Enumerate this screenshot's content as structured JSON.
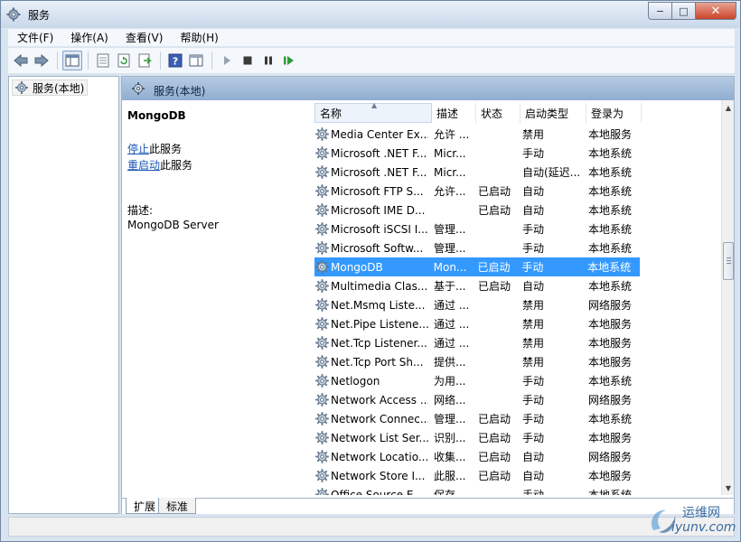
{
  "window": {
    "title": "服务",
    "controls": {
      "minimize": "−",
      "maximize": "□",
      "close": "✕"
    }
  },
  "menu": [
    "文件(F)",
    "操作(A)",
    "查看(V)",
    "帮助(H)"
  ],
  "toolbar": {
    "icons": [
      "back-arrow-icon",
      "forward-arrow-icon",
      "console-tree-icon",
      "properties-icon",
      "refresh-icon",
      "export-list-icon",
      "help-icon",
      "action-pane-icon",
      "start-service-icon",
      "stop-service-icon",
      "pause-service-icon",
      "restart-service-icon"
    ]
  },
  "tree": {
    "root_label": "服务(本地)"
  },
  "pane_header": {
    "title": "服务(本地)"
  },
  "detail": {
    "service_name": "MongoDB",
    "stop_link": "停止",
    "stop_suffix": "此服务",
    "restart_link": "重启动",
    "restart_suffix": "此服务",
    "desc_label": "描述:",
    "desc_text": "MongoDB Server"
  },
  "columns": [
    "名称",
    "描述",
    "状态",
    "启动类型",
    "登录为"
  ],
  "rows": [
    {
      "name": "Media Center Ex...",
      "desc": "允许 ...",
      "status": "",
      "startup": "禁用",
      "logon": "本地服务"
    },
    {
      "name": "Microsoft .NET F...",
      "desc": "Micr...",
      "status": "",
      "startup": "手动",
      "logon": "本地系统"
    },
    {
      "name": "Microsoft .NET F...",
      "desc": "Micr...",
      "status": "",
      "startup": "自动(延迟...",
      "logon": "本地系统"
    },
    {
      "name": "Microsoft FTP S...",
      "desc": "允许...",
      "status": "已启动",
      "startup": "自动",
      "logon": "本地系统"
    },
    {
      "name": "Microsoft IME D...",
      "desc": "",
      "status": "已启动",
      "startup": "自动",
      "logon": "本地系统"
    },
    {
      "name": "Microsoft iSCSI I...",
      "desc": "管理...",
      "status": "",
      "startup": "手动",
      "logon": "本地系统"
    },
    {
      "name": "Microsoft Softw...",
      "desc": "管理...",
      "status": "",
      "startup": "手动",
      "logon": "本地系统"
    },
    {
      "name": "MongoDB",
      "desc": "Mon...",
      "status": "已启动",
      "startup": "手动",
      "logon": "本地系统",
      "selected": true
    },
    {
      "name": "Multimedia Clas...",
      "desc": "基于...",
      "status": "已启动",
      "startup": "自动",
      "logon": "本地系统"
    },
    {
      "name": "Net.Msmq Liste...",
      "desc": "通过 ...",
      "status": "",
      "startup": "禁用",
      "logon": "网络服务"
    },
    {
      "name": "Net.Pipe Listene...",
      "desc": "通过 ...",
      "status": "",
      "startup": "禁用",
      "logon": "本地服务"
    },
    {
      "name": "Net.Tcp Listener...",
      "desc": "通过 ...",
      "status": "",
      "startup": "禁用",
      "logon": "本地服务"
    },
    {
      "name": "Net.Tcp Port Sh...",
      "desc": "提供...",
      "status": "",
      "startup": "禁用",
      "logon": "本地服务"
    },
    {
      "name": "Netlogon",
      "desc": "为用...",
      "status": "",
      "startup": "手动",
      "logon": "本地系统"
    },
    {
      "name": "Network Access ...",
      "desc": "网络...",
      "status": "",
      "startup": "手动",
      "logon": "网络服务"
    },
    {
      "name": "Network Connec...",
      "desc": "管理...",
      "status": "已启动",
      "startup": "手动",
      "logon": "本地系统"
    },
    {
      "name": "Network List Ser...",
      "desc": "识别...",
      "status": "已启动",
      "startup": "手动",
      "logon": "本地服务"
    },
    {
      "name": "Network Locatio...",
      "desc": "收集...",
      "status": "已启动",
      "startup": "自动",
      "logon": "网络服务"
    },
    {
      "name": "Network Store I...",
      "desc": "此服...",
      "status": "已启动",
      "startup": "自动",
      "logon": "本地服务"
    },
    {
      "name": "Office Source E...",
      "desc": "保存...",
      "status": "",
      "startup": "手动",
      "logon": "本地系统"
    }
  ],
  "tabs": [
    "扩展",
    "标准"
  ],
  "watermark": {
    "line1": "运维网",
    "line2": "iyunv.com"
  }
}
